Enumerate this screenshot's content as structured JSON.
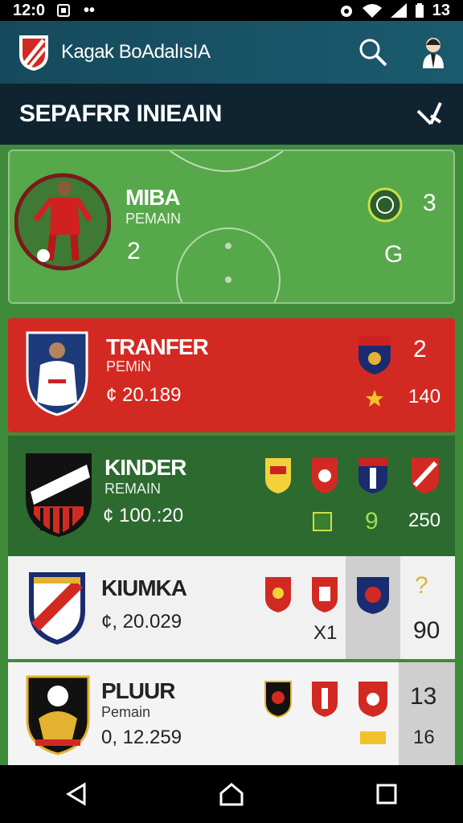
{
  "status": {
    "time": "12:0",
    "battery": "13"
  },
  "app": {
    "title": "Kagak BoAdalısIA"
  },
  "section": {
    "title": "SEPAFRR INIEAIN"
  },
  "cards": [
    {
      "name": "MIBA",
      "sub": "PEMAIN",
      "left_value": "2",
      "right_top": "3",
      "right_bottom": "G"
    },
    {
      "name": "TRANFER",
      "sub": "PEMiN",
      "price": "¢ 20.189",
      "right_top": "2",
      "right_bottom": "140"
    },
    {
      "name": "KINDER",
      "sub": "REMAIN",
      "price": "¢ 100.:20",
      "right_mid": "9",
      "right_bottom": "250"
    },
    {
      "name": "KIUMKA",
      "price": "¢, 20.029",
      "mid_value": "X1",
      "right_top": "?",
      "right_bottom": "90"
    },
    {
      "name": "PLUUR",
      "sub": "Pemain",
      "price": "0, 12.259",
      "right_top": "13",
      "right_bottom": "16"
    }
  ],
  "colors": {
    "header": "#154a5c",
    "section": "#0f2331",
    "pitch": "#57a84a",
    "red": "#d22a22",
    "dark_green": "#2c6a30"
  }
}
